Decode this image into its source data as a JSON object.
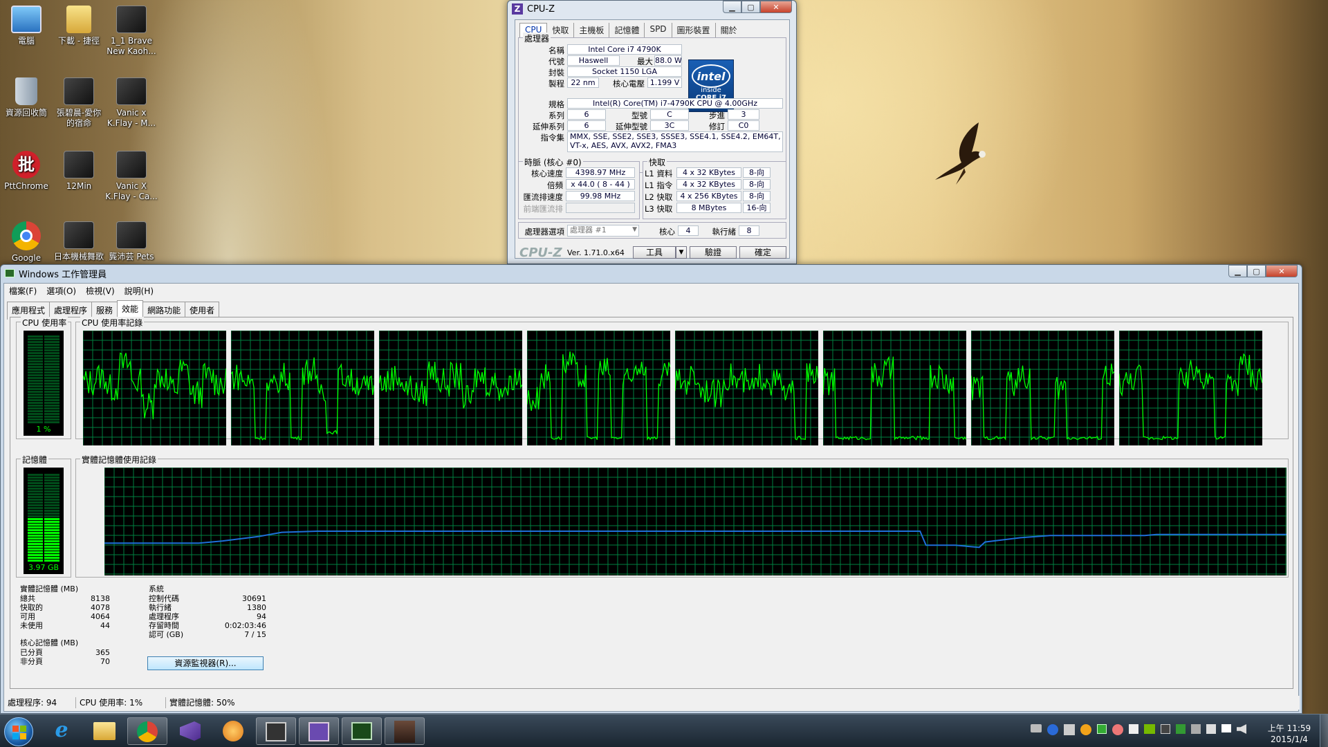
{
  "desktop": {
    "icons": [
      {
        "label": "電腦"
      },
      {
        "label": "下載 - 捷徑"
      },
      {
        "label": "1_1 Brave New Kaoh..."
      },
      {
        "label": "資源回收筒"
      },
      {
        "label": "張碧晨-愛你的宿命"
      },
      {
        "label": "Vanic x K.Flay - M..."
      },
      {
        "label": "PttChrome"
      },
      {
        "label": "12Min"
      },
      {
        "label": "Vanic X K.Flay - Ca..."
      },
      {
        "label": "Google"
      },
      {
        "label": "日本機械舞歌"
      },
      {
        "label": "龔沛芸 Pets"
      }
    ],
    "pttchrome_glyph": "批"
  },
  "cpuz": {
    "title": "CPU-Z",
    "icon_glyph": "Z",
    "tabs": [
      "CPU",
      "快取",
      "主機板",
      "記憶體",
      "SPD",
      "圖形裝置",
      "關於"
    ],
    "processor_group": "處理器",
    "labels": {
      "name": "名稱",
      "codename": "代號",
      "max_tdp": "最大 TDP",
      "package": "封裝",
      "technology": "製程",
      "core_voltage": "核心電壓",
      "specification": "規格",
      "family": "系列",
      "model": "型號",
      "stepping": "步進",
      "ext_family": "延伸系列",
      "ext_model": "延伸型號",
      "revision": "修訂",
      "instructions": "指令集"
    },
    "values": {
      "name": "Intel Core i7 4790K",
      "codename": "Haswell",
      "max_tdp": "88.0 W",
      "package": "Socket 1150 LGA",
      "technology": "22 nm",
      "core_voltage": "1.199 V",
      "specification": "Intel(R) Core(TM) i7-4790K CPU @ 4.00GHz",
      "family": "6",
      "model": "C",
      "stepping": "3",
      "ext_family": "6",
      "ext_model": "3C",
      "revision": "C0",
      "instructions_1": "MMX, SSE, SSE2, SSE3, SSSE3, SSE4.1, SSE4.2, EM64T,",
      "instructions_2": "VT-x, AES, AVX, AVX2, FMA3"
    },
    "intel_logo": {
      "word": "intel",
      "inside": "inside",
      "brand": "CORE i7"
    },
    "clocks_group": "時脈 (核心 #0)",
    "clocks": {
      "core_speed_label": "核心速度",
      "core_speed": "4398.97 MHz",
      "multiplier_label": "倍頻",
      "multiplier": "x 44.0 ( 8 - 44 )",
      "bus_speed_label": "匯流排速度",
      "bus_speed": "99.98 MHz",
      "rated_fsb_label": "前端匯流排",
      "rated_fsb": ""
    },
    "cache_group": "快取",
    "cache": [
      {
        "label": "L1 資料",
        "size": "4 x 32 KBytes",
        "way": "8-向"
      },
      {
        "label": "L1 指令",
        "size": "4 x 32 KBytes",
        "way": "8-向"
      },
      {
        "label": "L2 快取",
        "size": "4 x 256 KBytes",
        "way": "8-向"
      },
      {
        "label": "L3 快取",
        "size": "8 MBytes",
        "way": "16-向"
      }
    ],
    "selection_label": "處理器選項",
    "selection_value": "處理器 #1",
    "cores_label": "核心",
    "cores": "4",
    "threads_label": "執行緒",
    "threads": "8",
    "brand": "CPU-Z",
    "version": "Ver. 1.71.0.x64",
    "tools_button": "工具",
    "validate_button": "驗證",
    "ok_button": "確定"
  },
  "taskmgr": {
    "title": "Windows 工作管理員",
    "menu": [
      "檔案(F)",
      "選項(O)",
      "檢視(V)",
      "說明(H)"
    ],
    "tabs": [
      "應用程式",
      "處理程序",
      "服務",
      "效能",
      "網路功能",
      "使用者"
    ],
    "active_tab": "效能",
    "cpu_usage_title": "CPU 使用率",
    "cpu_usage_value": "1 %",
    "cpu_usage_fraction": 0.01,
    "cpu_history_title": "CPU 使用率記錄",
    "memory_title": "記憶體",
    "memory_value": "3.97 GB",
    "memory_fraction": 0.49,
    "memory_history_title": "實體記憶體使用記錄",
    "physical_memory": {
      "title": "實體記憶體 (MB)",
      "rows": [
        {
          "label": "總共",
          "value": "8138"
        },
        {
          "label": "快取的",
          "value": "4078"
        },
        {
          "label": "可用",
          "value": "4064"
        },
        {
          "label": "未使用",
          "value": "44"
        }
      ]
    },
    "kernel_memory": {
      "title": "核心記憶體 (MB)",
      "rows": [
        {
          "label": "已分頁",
          "value": "365"
        },
        {
          "label": "非分頁",
          "value": "70"
        }
      ]
    },
    "system": {
      "title": "系統",
      "rows": [
        {
          "label": "控制代碼",
          "value": "30691"
        },
        {
          "label": "執行緒",
          "value": "1380"
        },
        {
          "label": "處理程序",
          "value": "94"
        },
        {
          "label": "存留時間",
          "value": "0:02:03:46"
        },
        {
          "label": "認可 (GB)",
          "value": "7 / 15"
        }
      ]
    },
    "resource_monitor_button": "資源監視器(R)...",
    "status": {
      "processes": "處理程序: 94",
      "cpu": "CPU 使用率: 1%",
      "memory": "實體記憶體: 50%"
    },
    "colors": {
      "grid": "#008040",
      "cpu_line": "#00ff00",
      "mem_line": "#1e6fd9"
    }
  },
  "taskbar": {
    "clock_period": "上午 11:59",
    "clock_date": "2015/1/4",
    "apps": [
      "start",
      "ie",
      "explorer",
      "chrome",
      "visual-studio",
      "media",
      "hardware-monitor",
      "cpu-z",
      "task-manager",
      "photo"
    ]
  }
}
